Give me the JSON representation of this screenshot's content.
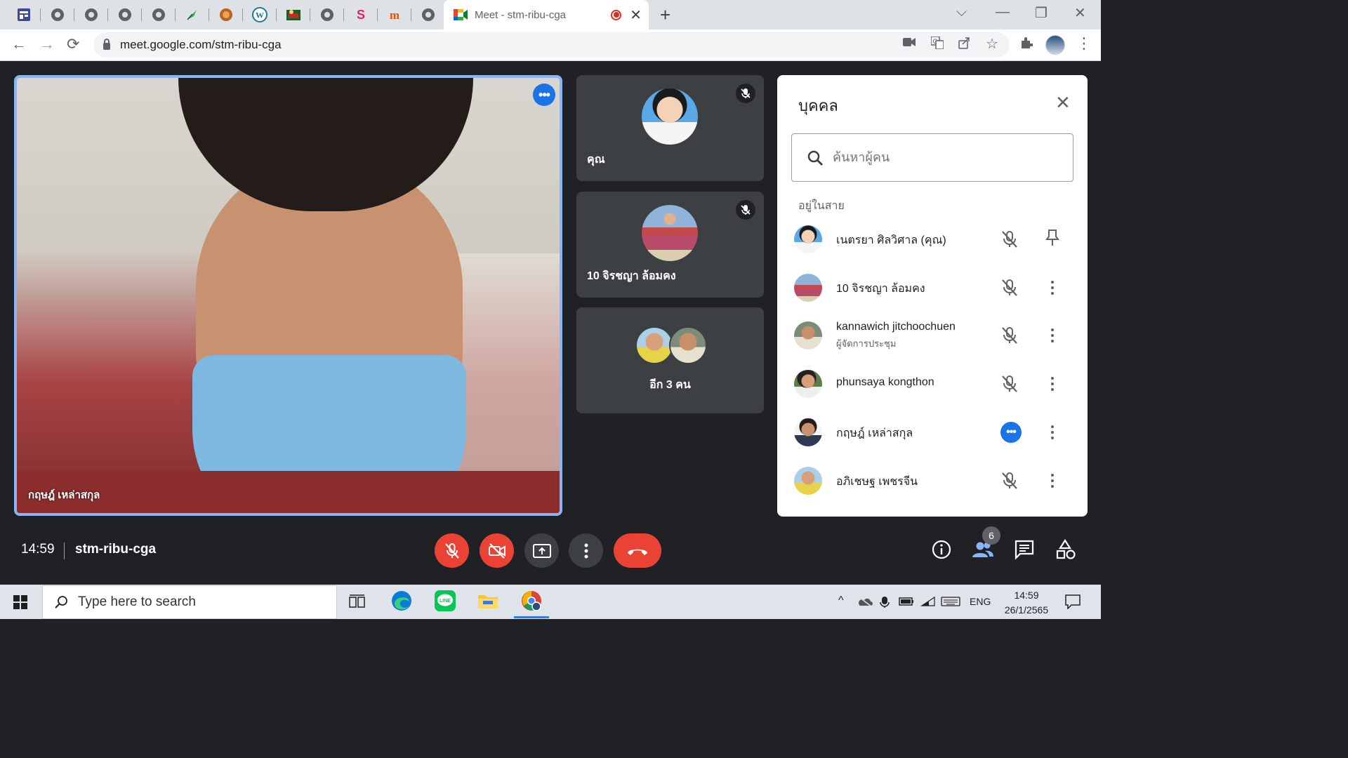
{
  "browser": {
    "active_tab_title": "Meet - stm-ribu-cga",
    "url": "meet.google.com/stm-ribu-cga",
    "pinned_tabs": [
      "sheets-icon",
      "globe-icon",
      "globe-icon",
      "globe-icon",
      "globe-icon",
      "feather-icon",
      "seal-icon",
      "wordpress-icon",
      "game-icon",
      "globe-icon",
      "s-logo-icon",
      "m-logo-icon",
      "globe-icon"
    ]
  },
  "meeting": {
    "main_speaker": "กฤษฎ์ เหล่าสกุล",
    "tiles": [
      {
        "label": "คุณ",
        "muted": true
      },
      {
        "label": "10 จิรชญา ล้อมคง",
        "muted": true
      },
      {
        "label": "อีก 3 คน"
      }
    ],
    "time": "14:59",
    "code": "stm-ribu-cga",
    "participant_count": "6"
  },
  "people_panel": {
    "title": "บุคคล",
    "search_placeholder": "ค้นหาผู้คน",
    "section_label": "อยู่ในสาย",
    "people": [
      {
        "name": "เนตรยา ศิลวิศาล (คุณ)",
        "role": "",
        "state": "muted",
        "action": "pin"
      },
      {
        "name": "10 จิรชญา ล้อมคง",
        "role": "",
        "state": "muted",
        "action": "more"
      },
      {
        "name": "kannawich jitchoochuen",
        "role": "ผู้จัดการประชุม",
        "state": "muted",
        "action": "more"
      },
      {
        "name": "phunsaya kongthon",
        "role": "",
        "state": "muted",
        "action": "more"
      },
      {
        "name": "กฤษฎ์ เหล่าสกุล",
        "role": "",
        "state": "talking",
        "action": "more"
      },
      {
        "name": "อภิเชษฐ เพชรจีน",
        "role": "",
        "state": "muted",
        "action": "more"
      }
    ]
  },
  "taskbar": {
    "search_placeholder": "Type here to search",
    "language": "ENG",
    "clock_time": "14:59",
    "clock_date": "26/1/2565"
  },
  "colors": {
    "meet_bg": "#202124",
    "tile_bg": "#3c4043",
    "accent_blue": "#1a73e8",
    "danger_red": "#ea4335",
    "speaker_border": "#8ab4f8"
  }
}
